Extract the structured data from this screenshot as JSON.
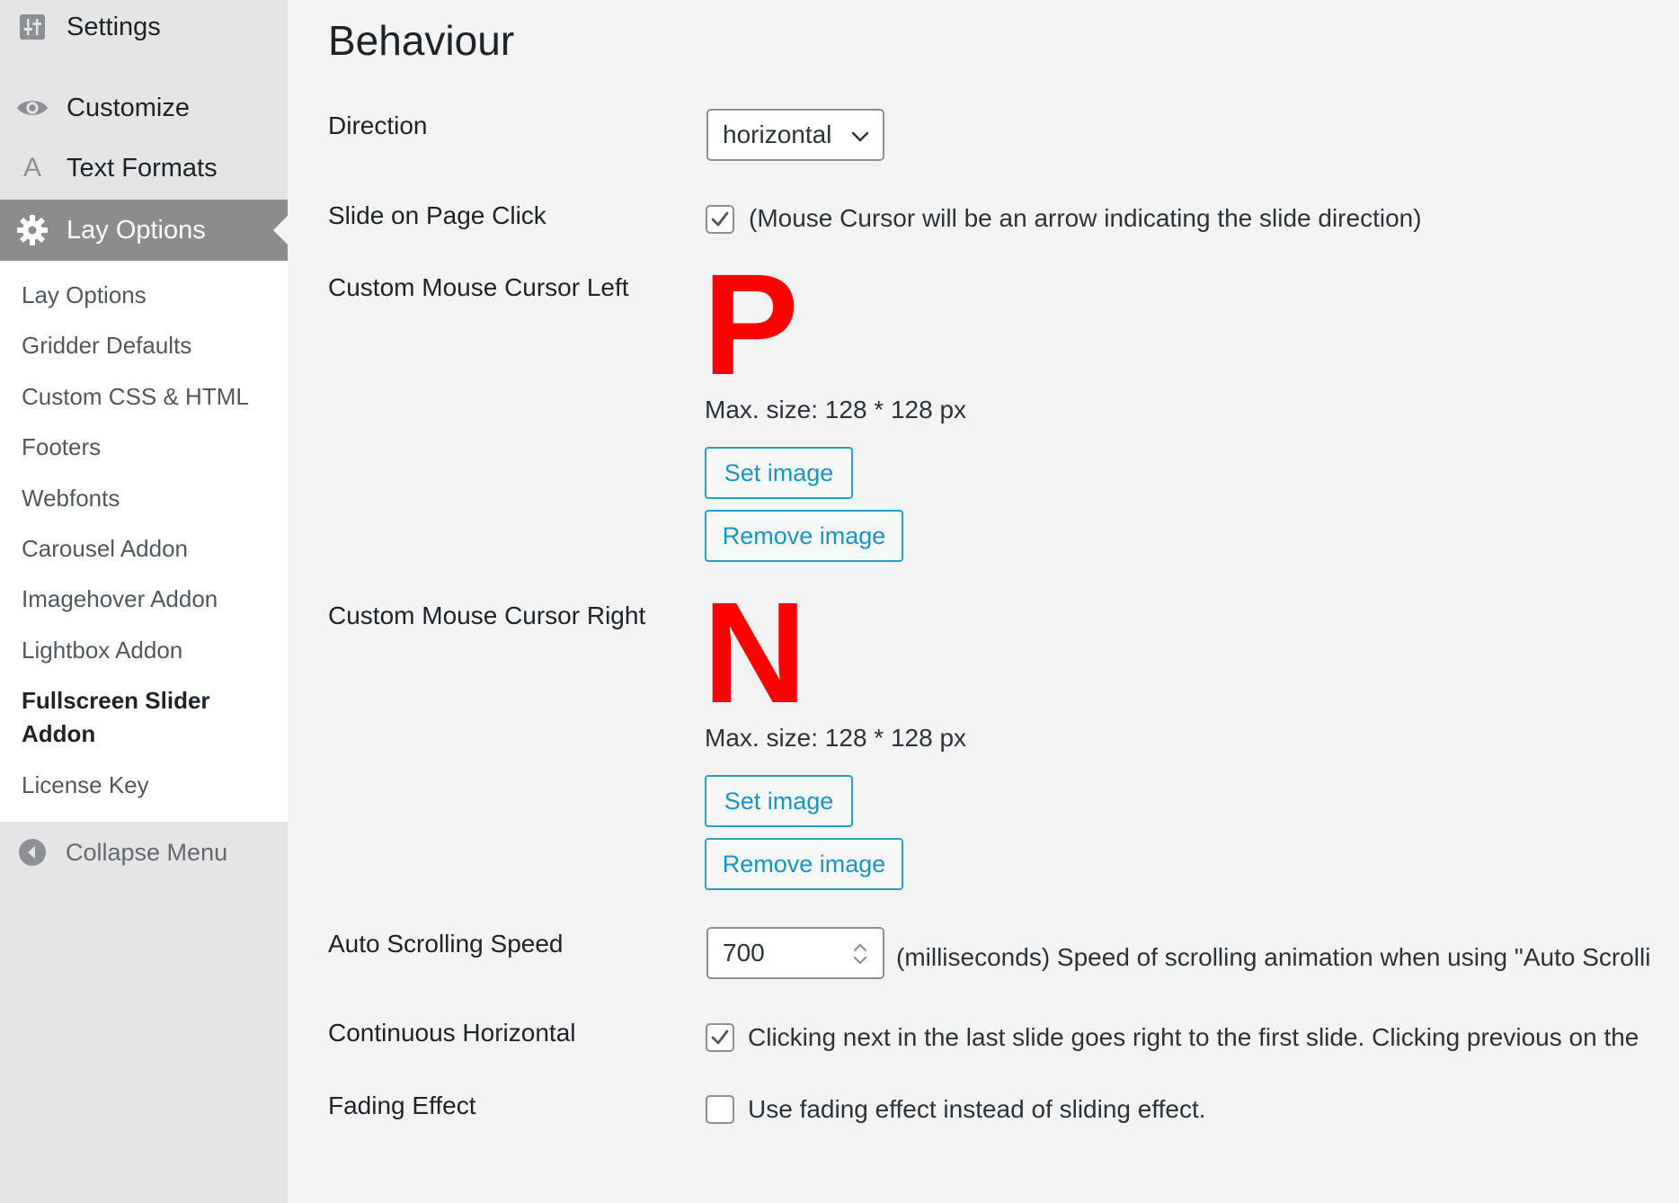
{
  "sidebar": {
    "menu": [
      {
        "label": "Settings",
        "icon": "settings-sliders-icon"
      },
      {
        "label": "Customize",
        "icon": "eye-icon"
      },
      {
        "label": "Text Formats",
        "icon": "text-a-icon"
      },
      {
        "label": "Lay Options",
        "icon": "gear-icon",
        "current": true
      }
    ],
    "submenu": [
      {
        "label": "Lay Options"
      },
      {
        "label": "Gridder Defaults"
      },
      {
        "label": "Custom CSS & HTML"
      },
      {
        "label": "Footers"
      },
      {
        "label": "Webfonts"
      },
      {
        "label": "Carousel Addon"
      },
      {
        "label": "Imagehover Addon"
      },
      {
        "label": "Lightbox Addon"
      },
      {
        "label": "Fullscreen Slider Addon",
        "current": true
      },
      {
        "label": "License Key"
      }
    ],
    "collapse_label": "Collapse Menu"
  },
  "main": {
    "title": "Behaviour",
    "direction": {
      "label": "Direction",
      "value": "horizontal"
    },
    "slide_on_click": {
      "label": "Slide on Page Click",
      "checked": true,
      "description": "(Mouse Cursor will be an arrow indicating the slide direction)"
    },
    "cursor_left": {
      "label": "Custom Mouse Cursor Left",
      "preview_glyph": "P",
      "preview_color": "#ff0000",
      "max_size": "Max. size: 128 * 128 px",
      "set_label": "Set image",
      "remove_label": "Remove image"
    },
    "cursor_right": {
      "label": "Custom Mouse Cursor Right",
      "preview_glyph": "N",
      "preview_color": "#ff0000",
      "max_size": "Max. size: 128 * 128 px",
      "set_label": "Set image",
      "remove_label": "Remove image"
    },
    "auto_scroll": {
      "label": "Auto Scrolling Speed",
      "value": "700",
      "description": "(milliseconds) Speed of scrolling animation when using \"Auto Scrolli"
    },
    "continuous": {
      "label": "Continuous Horizontal",
      "checked": true,
      "description": "Clicking next in the last slide goes right to the first slide. Clicking previous on the"
    },
    "fading": {
      "label": "Fading Effect",
      "checked": false,
      "description": "Use fading effect instead of sliding effect."
    }
  },
  "colors": {
    "accent": "#1b95bf",
    "sidebar_bg": "#e5e5e5",
    "current_menu_bg": "#8c8c8c",
    "page_bg": "#f3f3f3"
  }
}
